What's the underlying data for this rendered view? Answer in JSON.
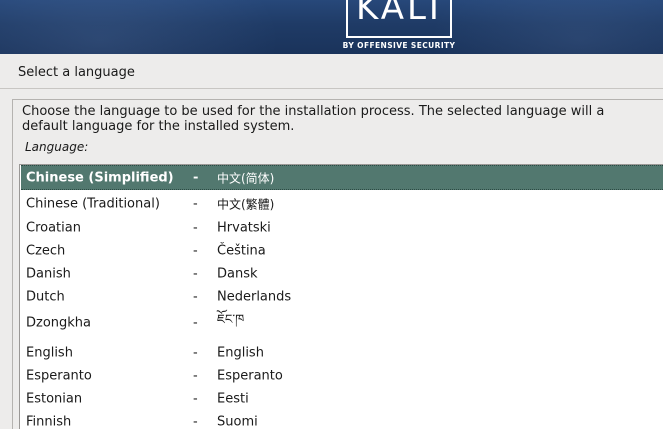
{
  "branding": {
    "logo_text": "KALI",
    "logo_subtitle": "BY OFFENSIVE SECURITY"
  },
  "step_title": "Select a language",
  "description": {
    "line1": "Choose the language to be used for the installation process. The selected language will a",
    "line2": "default language for the installed system."
  },
  "field_label": "Language:",
  "separator": "-",
  "languages": [
    {
      "name": "Chinese (Simplified)",
      "native": "中文(简体)",
      "selected": true
    },
    {
      "name": "Chinese (Traditional)",
      "native": "中文(繁體)",
      "selected": false
    },
    {
      "name": "Croatian",
      "native": "Hrvatski",
      "selected": false
    },
    {
      "name": "Czech",
      "native": "Čeština",
      "selected": false
    },
    {
      "name": "Danish",
      "native": "Dansk",
      "selected": false
    },
    {
      "name": "Dutch",
      "native": "Nederlands",
      "selected": false
    },
    {
      "name": "Dzongkha",
      "native": "ཇོང་ཁ",
      "selected": false
    },
    {
      "name": "English",
      "native": "English",
      "selected": false
    },
    {
      "name": "Esperanto",
      "native": "Esperanto",
      "selected": false
    },
    {
      "name": "Estonian",
      "native": "Eesti",
      "selected": false
    },
    {
      "name": "Finnish",
      "native": "Suomi",
      "selected": false
    }
  ],
  "colors": {
    "banner": "#1f3b66",
    "selection": "#52786f",
    "background": "#edeceb"
  }
}
